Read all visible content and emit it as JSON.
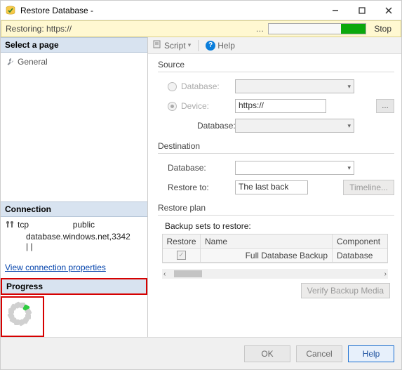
{
  "titlebar": {
    "title": "Restore Database -"
  },
  "restoring": {
    "label": "Restoring: https://",
    "stop": "Stop"
  },
  "left": {
    "select_page": "Select a page",
    "general": "General",
    "connection_header": "Connection",
    "conn_line1a": "tcp",
    "conn_line1b": "public",
    "conn_line2": "database.windows.net,3342",
    "conn_line3": "|               |",
    "view_link": "View connection properties",
    "progress_header": "Progress"
  },
  "toolbar": {
    "script": "Script",
    "help": "Help"
  },
  "source": {
    "header": "Source",
    "database_label": "Database:",
    "device_label": "Device:",
    "device_value": "https://",
    "inner_database_label": "Database:"
  },
  "destination": {
    "header": "Destination",
    "database_label": "Database:",
    "restore_to_label": "Restore to:",
    "restore_to_value": "The last back",
    "timeline": "Timeline..."
  },
  "plan": {
    "header": "Restore plan",
    "subhead": "Backup sets to restore:",
    "cols": {
      "restore": "Restore",
      "name": "Name",
      "component": "Component"
    },
    "row": {
      "name": "Full Database Backup",
      "component": "Database"
    },
    "verify": "Verify Backup Media"
  },
  "footer": {
    "ok": "OK",
    "cancel": "Cancel",
    "help": "Help"
  }
}
